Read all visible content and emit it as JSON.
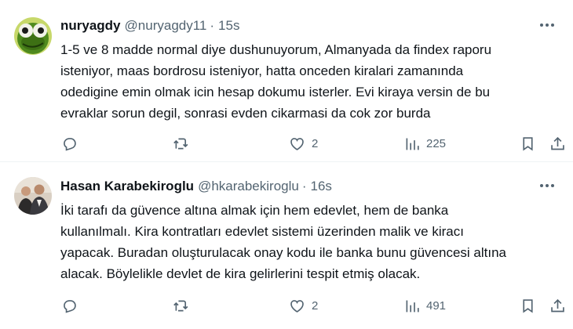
{
  "tweets": [
    {
      "name": "nuryagdy",
      "handle": "@nuryagdy11",
      "separator": "·",
      "time": "15s",
      "text": "1-5 ve 8 madde normal diye dushunuyorum, Almanyada da findex raporu\nisteniyor, maas bordrosu isteniyor, hatta onceden kiralari zamanında\nodedigine emin olmak icin hesap dokumu isterler. Evi kiraya versin de bu\nevraklar sorun degil, sonrasi evden cikarmasi da cok zor burda",
      "likes": "2",
      "views": "225",
      "avatar_icon": "frog-avatar-icon"
    },
    {
      "name": "Hasan Karabekiroglu",
      "handle": "@hkarabekiroglu",
      "separator": "·",
      "time": "16s",
      "text": "İki tarafı da güvence altına almak için hem edevlet, hem de banka\nkullanılmalı. Kira kontratları edevlet sistemi üzerinden malik ve kiracı\nyapacak. Buradan oluşturulacak onay kodu ile banka bunu güvencesi altına\nalacak. Böylelikle devlet de kira gelirlerini tespit etmiş olacak.",
      "likes": "2",
      "views": "491",
      "avatar_icon": "person-photo-avatar-icon"
    }
  ],
  "icons": {
    "more": "more-dots-icon",
    "reply": "reply-icon",
    "retweet": "retweet-icon",
    "like": "heart-icon",
    "views": "views-chart-icon",
    "bookmark": "bookmark-icon",
    "share": "share-icon"
  },
  "colors": {
    "text": "#0f1419",
    "secondary": "#536471",
    "divider": "#eff3f4"
  }
}
